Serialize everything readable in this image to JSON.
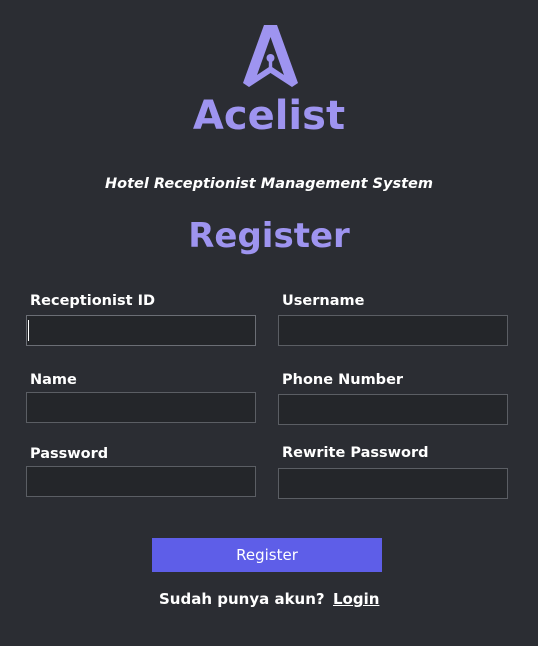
{
  "brand": {
    "name": "Acelist",
    "logo_icon": "lock-a-icon",
    "accent_color": "#9e94f0"
  },
  "subtitle": "Hotel Receptionist Management System",
  "page_title": "Register",
  "form": {
    "receptionist_id": {
      "label": "Receptionist ID",
      "value": ""
    },
    "username": {
      "label": "Username",
      "value": ""
    },
    "name": {
      "label": "Name",
      "value": ""
    },
    "phone_number": {
      "label": "Phone Number",
      "value": ""
    },
    "password": {
      "label": "Password",
      "value": ""
    },
    "rewrite_password": {
      "label": "Rewrite Password",
      "value": ""
    }
  },
  "register_button": {
    "label": "Register",
    "color": "#5e5ee8"
  },
  "footer": {
    "prompt": "Sudah punya akun?",
    "login_link": "Login"
  }
}
